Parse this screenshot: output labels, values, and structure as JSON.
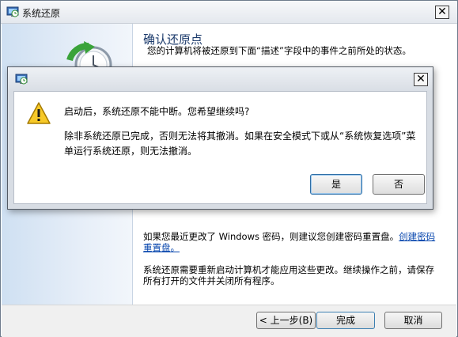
{
  "main_window": {
    "title": "系统还原",
    "close_glyph": "✕",
    "heading": "确认还原点",
    "description": "您的计算机将被还原到下面“描述”字段中的事件之前所处的状态。",
    "password_text": "如果您最近更改了 Windows 密码，则建议您创建密码重置盘。",
    "password_link": "创建密码重置盘。",
    "restart_text": "系统还原需要重新启动计算机才能应用这些更改。继续操作之前，请保存所有打开的文件并关闭所有程序。",
    "buttons": {
      "back": "< 上一步(B)",
      "finish": "完成",
      "cancel": "取消"
    },
    "icons": {
      "title_icon": "system-restore-icon",
      "wizard_art": "system-restore-clock-icon"
    }
  },
  "dialog": {
    "close_glyph": "✕",
    "question": "启动后，系统还原不能中断。您希望继续吗?",
    "message": "除非系统还原已完成，否则无法将其撤消。如果在安全模式下或从“系统恢复选项”菜单运行系统还原，则无法撤消。",
    "buttons": {
      "yes": "是",
      "no": "否"
    },
    "icons": {
      "title_icon": "system-restore-icon",
      "warning": "warning-icon"
    }
  }
}
